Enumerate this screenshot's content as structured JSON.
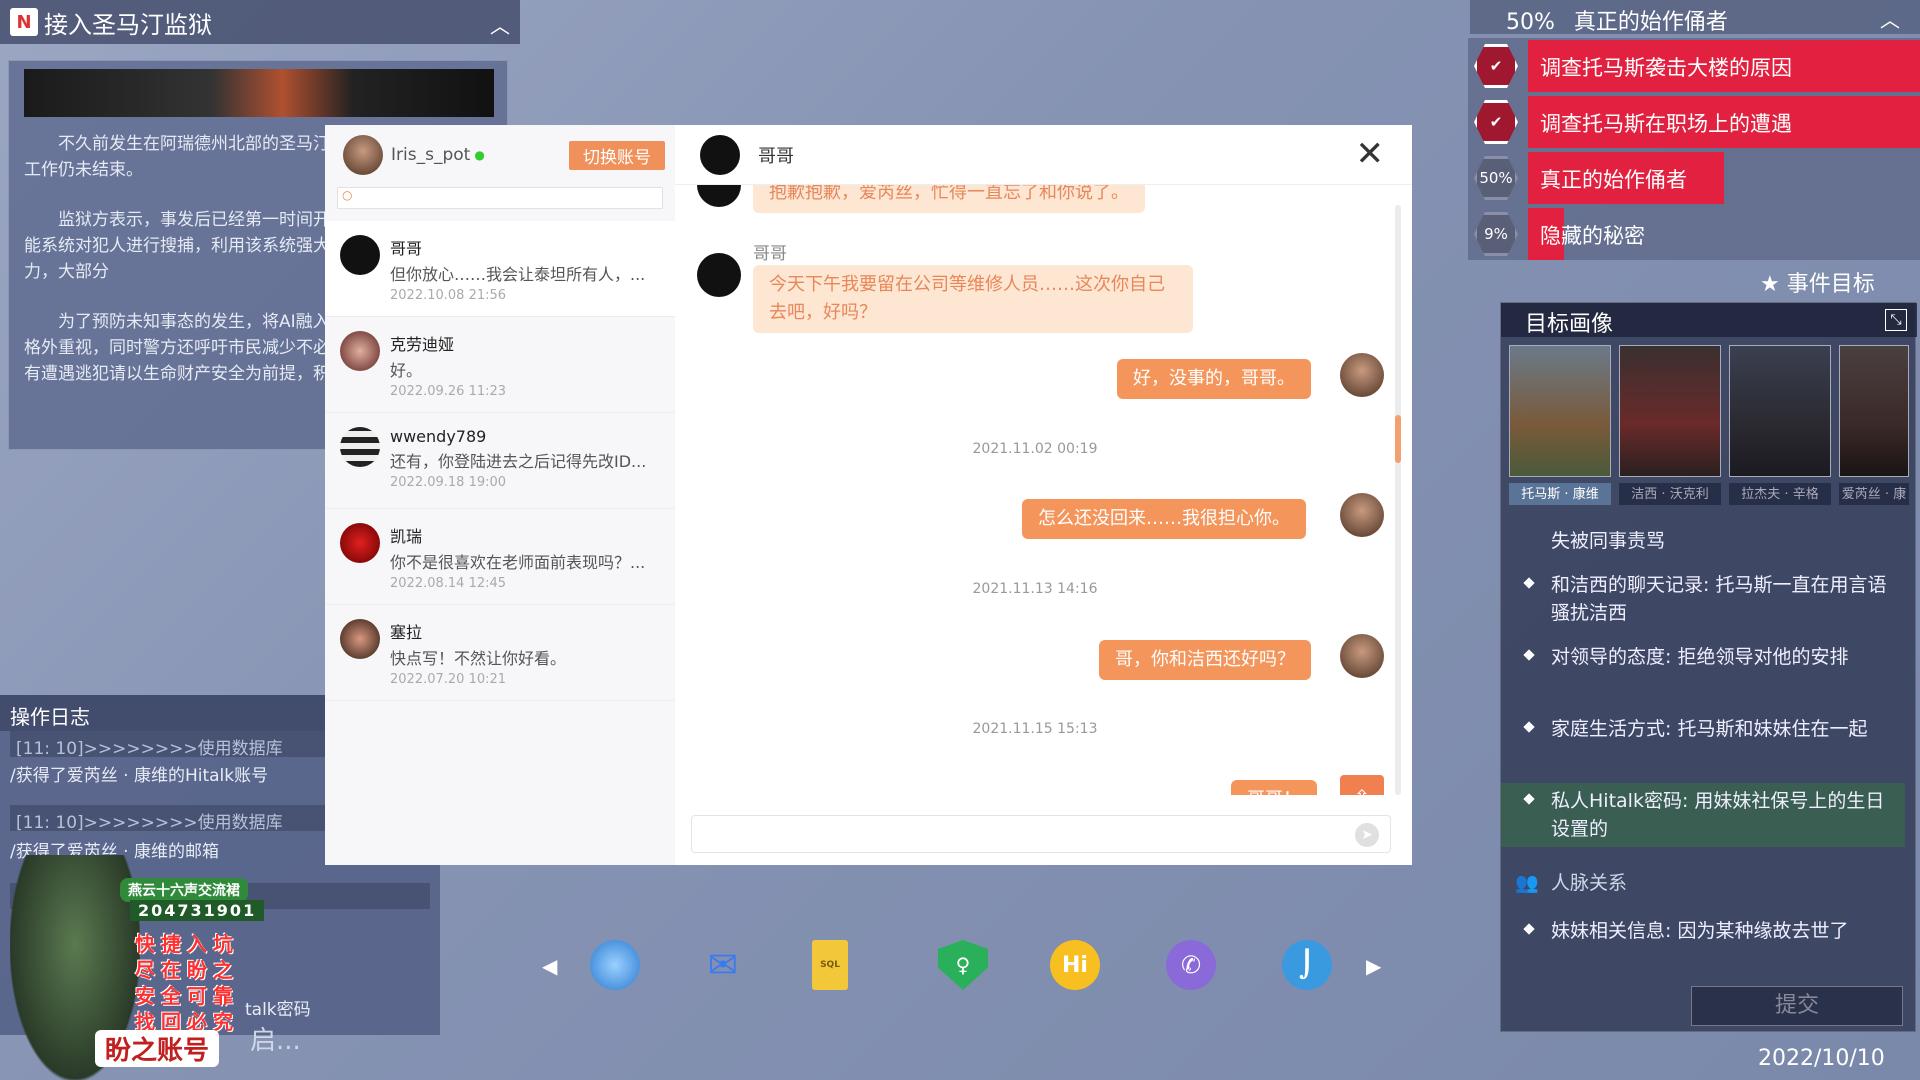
{
  "news": {
    "title": "接入圣马汀监狱",
    "paragraphs": [
      "不久前发生在阿瑞德州北部的圣马汀监狱事件的后续抓捕工作仍未结束。",
      "监狱方表示，事发后已经第一时间开展工作，利用人工智能系统对犯人进行搜捕，利用该系统强大的数据汇总处理能力，大部分",
      "为了预防未知事态的发生，将AI融入监控系统受到警方的格外重视，同时警方还呼吁市民减少不必要的外出和聚集，如有遭遇逃犯请以生命财产安全为前提，积极提供线索。"
    ]
  },
  "log": {
    "title": "操作日志",
    "rows": [
      {
        "text": "[11: 10]>>>>>>>>使用数据库",
        "dim": true
      },
      {
        "text": "/获得了爱芮丝 · 康维的Hitalk账号",
        "dim": false
      },
      {
        "text": "[11: 10]>>>>>>>>使用数据库",
        "dim": true
      },
      {
        "text": "/获得了爱芮丝 · 康维的邮箱",
        "dim": false
      },
      {
        "text": "[11: 1",
        "dim": true
      }
    ],
    "footer": "启..."
  },
  "promo": {
    "tag": "燕云十六声交流裙",
    "number": "204731901",
    "lines": [
      "快捷入坑",
      "尽在盼之",
      "安全可靠",
      "找回必究"
    ],
    "brand": "盼之账号",
    "fragment": "talk密码"
  },
  "messenger": {
    "account": {
      "name": "Iris_s_pot",
      "switch_label": "切换账号"
    },
    "contacts": [
      {
        "name": "哥哥",
        "msg": "但你放心……我会让泰坦所有人，...",
        "time": "2022.10.08 21:56",
        "color": "#111"
      },
      {
        "name": "克劳迪娅",
        "msg": "好。",
        "time": "2022.09.26 11:23",
        "color": "#8a3a3a"
      },
      {
        "name": "wwendy789",
        "msg": "还有，你登陆进去之后记得先改ID...",
        "time": "2022.09.18 19:00",
        "color": "#444"
      },
      {
        "name": "凯瑞",
        "msg": "你不是很喜欢在老师面前表现吗？...",
        "time": "2022.08.14 12:45",
        "color": "#c01818"
      },
      {
        "name": "塞拉",
        "msg": "快点写！不然让你好看。",
        "time": "2022.07.20 10:21",
        "color": "#5a3a2a"
      }
    ],
    "chat": {
      "name": "哥哥",
      "sender_label": "哥哥",
      "msg_top": "抱歉抱歉，爱芮丝，忙得一直忘了和你说了。",
      "msg_in": "今天下午我要留在公司等维修人员……这次你自己去吧，好吗？",
      "msg_out1": "好，没事的，哥哥。",
      "ts1": "2021.11.02 00:19",
      "msg_out2": "怎么还没回来……我很担心你。",
      "ts2": "2021.11.13 14:16",
      "msg_out3": "哥，你和洁西还好吗？",
      "ts3": "2021.11.15 15:13",
      "msg_out4": "哥哥！"
    }
  },
  "objectives": {
    "header_percent": "50%",
    "header_title": "真正的始作俑者",
    "items": [
      {
        "label": "调查托马斯袭击大楼的原因",
        "status": "done",
        "fill": 1.0
      },
      {
        "label": "调查托马斯在职场上的遭遇",
        "status": "done",
        "fill": 1.0
      },
      {
        "label": "真正的始作俑者",
        "status": "50%",
        "fill": 0.5
      },
      {
        "label": "隐藏的秘密",
        "status": "9%",
        "fill": 0.09
      }
    ],
    "event_goal": "事件目标"
  },
  "target": {
    "title": "目标画像",
    "portraits": [
      {
        "label": "托马斯 · 康维",
        "selected": true,
        "color": "#7a5a3a"
      },
      {
        "label": "洁西 · 沃克利",
        "selected": false,
        "color": "#6a2a2a"
      },
      {
        "label": "拉杰夫 · 辛格",
        "selected": false,
        "color": "#2a2a30"
      },
      {
        "label": "爱芮丝 · 康",
        "selected": false,
        "color": "#3a2a28"
      }
    ],
    "clues": [
      {
        "text": "失被同事责骂",
        "dot": false,
        "hl": false
      },
      {
        "text": "和洁西的聊天记录: 托马斯一直在用言语骚扰洁西",
        "dot": true,
        "hl": false
      },
      {
        "text": "对领导的态度: 拒绝领导对他的安排",
        "dot": true,
        "hl": false
      },
      {
        "text": "家庭生活方式: 托马斯和妹妹住在一起",
        "dot": true,
        "hl": false
      },
      {
        "text": "私人Hitalk密码: 用妹妹社保号上的生日设置的",
        "dot": true,
        "hl": true
      }
    ],
    "relations_title": "人脉关系",
    "relation_clue": "妹妹相关信息: 因为某种缘故去世了",
    "submit_label": "提交"
  },
  "date": "2022/10/10",
  "dock": [
    "globe-icon",
    "mail-icon",
    "sql-file-icon",
    "shield-key-icon",
    "hitalk-icon",
    "phone-icon",
    "hook-icon"
  ]
}
